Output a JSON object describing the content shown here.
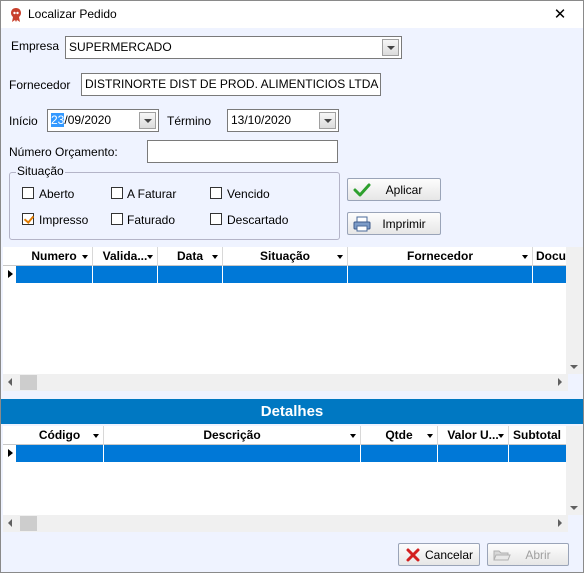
{
  "window": {
    "title": "Localizar Pedido",
    "close_glyph": "✕",
    "icon": "app-icon"
  },
  "filters": {
    "empresa_label": "Empresa",
    "empresa_value": "SUPERMERCADO",
    "fornecedor_label": "Fornecedor",
    "fornecedor_value": "DISTRINORTE DIST DE PROD. ALIMENTICIOS LTDA",
    "inicio_label": "Início",
    "inicio_day": "23",
    "inicio_rest": "/09/2020",
    "termino_label": "Término",
    "termino_value": "13/10/2020",
    "orcamento_label": "Número Orçamento:",
    "orcamento_value": ""
  },
  "situacao": {
    "title": "Situação",
    "options": [
      {
        "label": "Aberto",
        "checked": false
      },
      {
        "label": "A Faturar",
        "checked": false
      },
      {
        "label": "Vencido",
        "checked": false
      },
      {
        "label": "Impresso",
        "checked": true
      },
      {
        "label": "Faturado",
        "checked": false
      },
      {
        "label": "Descartado",
        "checked": false
      }
    ]
  },
  "actions": {
    "aplicar": {
      "label": "Aplicar",
      "icon": "checkmark-icon"
    },
    "imprimir": {
      "label": "Imprimir",
      "icon": "printer-icon"
    }
  },
  "orders_grid": {
    "columns": [
      "Numero",
      "Valida...",
      "Data",
      "Situação",
      "Fornecedor",
      "Docu"
    ],
    "rows": []
  },
  "details": {
    "title": "Detalhes",
    "columns": [
      "Código",
      "Descrição",
      "Qtde",
      "Valor U...",
      "Subtotal"
    ],
    "rows": []
  },
  "footer": {
    "cancelar": {
      "label": "Cancelar",
      "icon": "cancel-x-icon"
    },
    "abrir": {
      "label": "Abrir",
      "icon": "folder-open-icon",
      "enabled": false
    }
  },
  "colors": {
    "selection": "#0078d7",
    "band": "#0078c2",
    "client_bg": "#eff3ff"
  }
}
